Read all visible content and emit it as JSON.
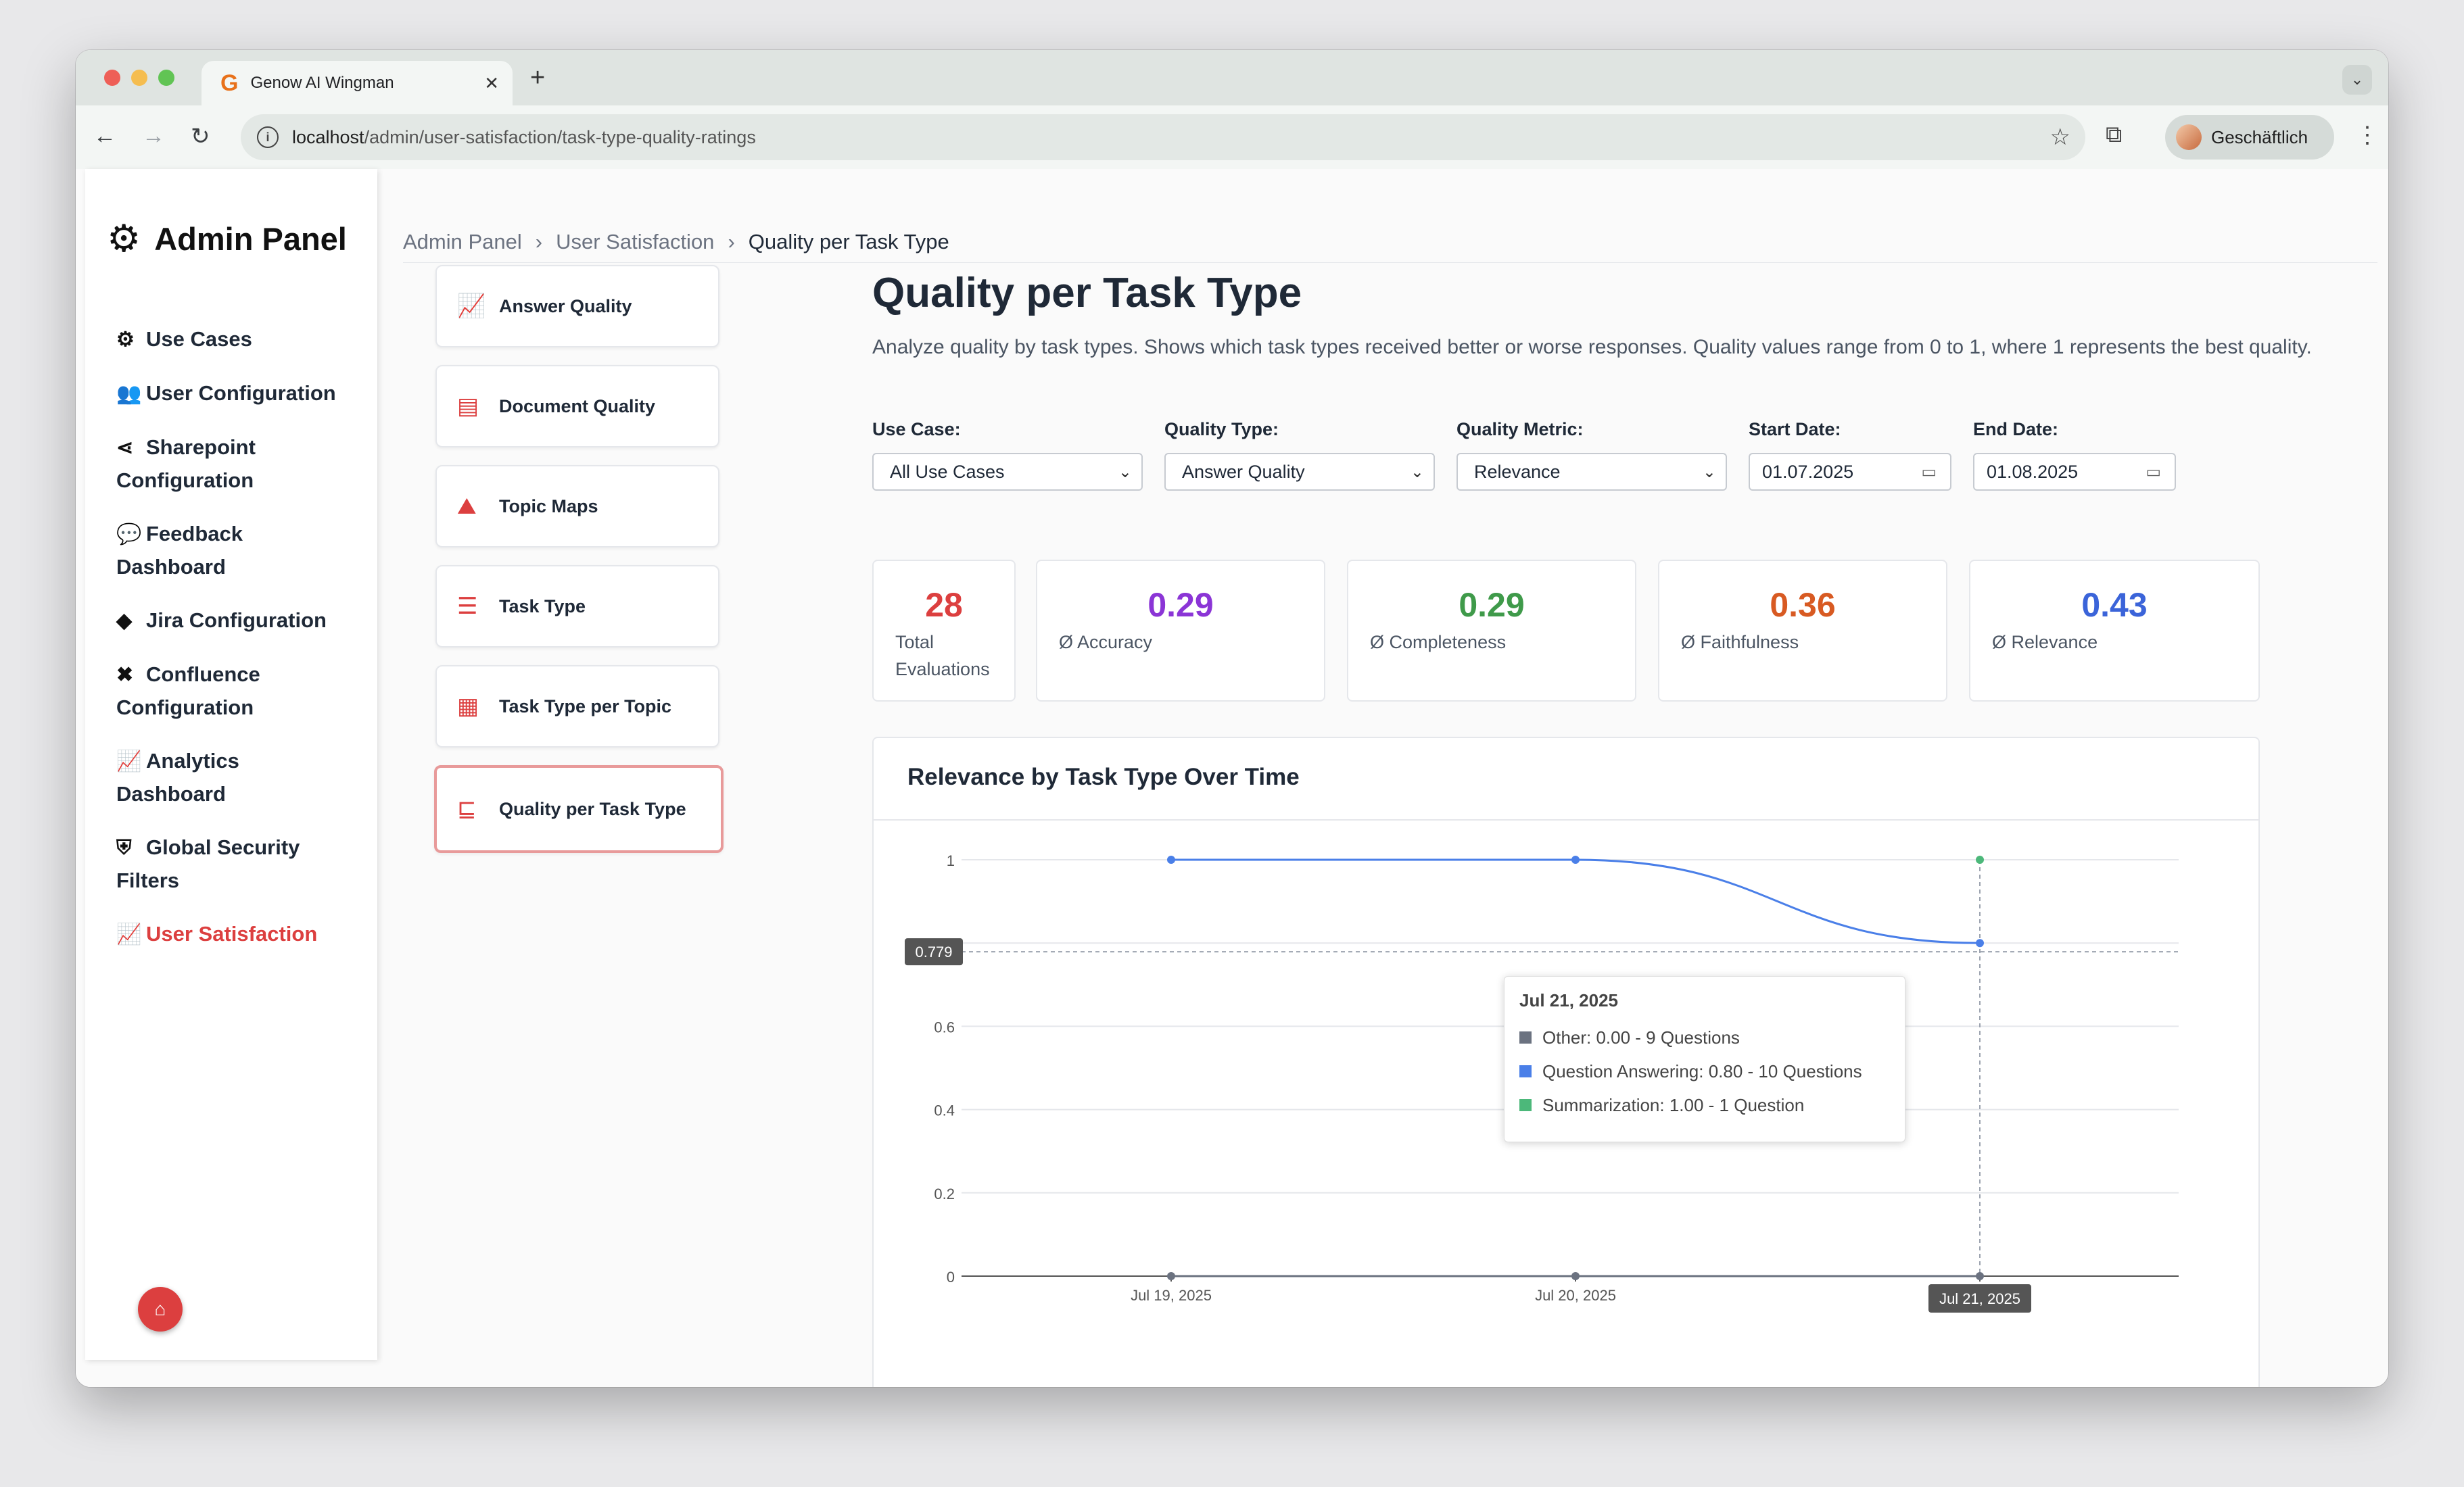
{
  "browser": {
    "tab_title": "Genow AI Wingman",
    "url_host": "localhost",
    "url_path": "/admin/user-satisfaction/task-type-quality-ratings",
    "profile_name": "Geschäftlich"
  },
  "sidebar": {
    "title": "Admin Panel",
    "items": [
      {
        "label": "Use Cases",
        "icon": "gears-icon"
      },
      {
        "label": "User Configuration",
        "icon": "users-gear-icon"
      },
      {
        "label": "Sharepoint Configuration",
        "line1": "Sharepoint",
        "line2": "Configuration",
        "icon": "share-icon"
      },
      {
        "label": "Feedback Dashboard",
        "line1": "Feedback",
        "line2": "Dashboard",
        "icon": "comments-icon"
      },
      {
        "label": "Jira Configuration",
        "icon": "jira-icon"
      },
      {
        "label": "Confluence Configuration",
        "line1": "Confluence",
        "line2": "Configuration",
        "icon": "confluence-icon"
      },
      {
        "label": "Analytics Dashboard",
        "line1": "Analytics",
        "line2": "Dashboard",
        "icon": "chart-line-icon"
      },
      {
        "label": "Global Security Filters",
        "line1": "Global Security",
        "line2": "Filters",
        "icon": "shield-icon"
      },
      {
        "label": "User Satisfaction",
        "icon": "chart-line-icon",
        "active": true
      }
    ]
  },
  "breadcrumb": [
    "Admin Panel",
    "User Satisfaction",
    "Quality per Task Type"
  ],
  "subnav": [
    {
      "label": "Answer Quality",
      "icon": "chart-line-icon"
    },
    {
      "label": "Document Quality",
      "icon": "file-icon"
    },
    {
      "label": "Topic Maps",
      "icon": "map-icon"
    },
    {
      "label": "Task Type",
      "icon": "list-check-icon"
    },
    {
      "label": "Task Type per Topic",
      "icon": "table-icon"
    },
    {
      "label": "Quality per Task Type",
      "icon": "chart-bar-icon",
      "active": true
    }
  ],
  "page": {
    "title": "Quality per Task Type",
    "description": "Analyze quality by task types. Shows which task types received better or worse responses. Quality values range from 0 to 1, where 1 represents the best quality."
  },
  "filters": {
    "use_case": {
      "label": "Use Case:",
      "value": "All Use Cases"
    },
    "quality_type": {
      "label": "Quality Type:",
      "value": "Answer Quality"
    },
    "quality_metric": {
      "label": "Quality Metric:",
      "value": "Relevance"
    },
    "start_date": {
      "label": "Start Date:",
      "value": "01.07.2025"
    },
    "end_date": {
      "label": "End Date:",
      "value": "01.08.2025"
    }
  },
  "stats": [
    {
      "value": "28",
      "label": "Total Evaluations",
      "line1": "Total",
      "line2": "Evaluations",
      "color": "#dc3f3f"
    },
    {
      "value": "0.29",
      "label": "Ø Accuracy",
      "color": "#8b35d6"
    },
    {
      "value": "0.29",
      "label": "Ø Completeness",
      "color": "#3f9a4a"
    },
    {
      "value": "0.36",
      "label": "Ø Faithfulness",
      "color": "#d85a22"
    },
    {
      "value": "0.43",
      "label": "Ø Relevance",
      "color": "#3b64d9"
    }
  ],
  "chart_title": "Relevance by Task Type Over Time",
  "chart_data": {
    "type": "line",
    "title": "Relevance by Task Type Over Time",
    "x": [
      "Jul 19, 2025",
      "Jul 20, 2025",
      "Jul 21, 2025"
    ],
    "ylim": [
      0,
      1
    ],
    "yticks": [
      "0",
      "0.2",
      "0.4",
      "0.6",
      "0.8",
      "1"
    ],
    "series": [
      {
        "name": "Other",
        "color": "#6b7280",
        "values": [
          0,
          0,
          0
        ]
      },
      {
        "name": "Question Answering",
        "color": "#4a7fe8",
        "values": [
          1,
          1,
          0.8
        ]
      },
      {
        "name": "Summarization",
        "color": "#4cb87a",
        "values": [
          null,
          null,
          1
        ]
      }
    ],
    "crosshair_y_label": "0.779",
    "crosshair_x_label": "Jul 21, 2025",
    "grid": true,
    "legend": "bottom"
  },
  "tooltip": {
    "date": "Jul 21, 2025",
    "rows": [
      {
        "text": "Other: 0.00 - 9 Questions",
        "color": "#6b7280"
      },
      {
        "text": "Question Answering: 0.80 - 10 Questions",
        "color": "#4a7fe8"
      },
      {
        "text": "Summarization: 1.00 - 1 Question",
        "color": "#4cb87a"
      }
    ]
  }
}
